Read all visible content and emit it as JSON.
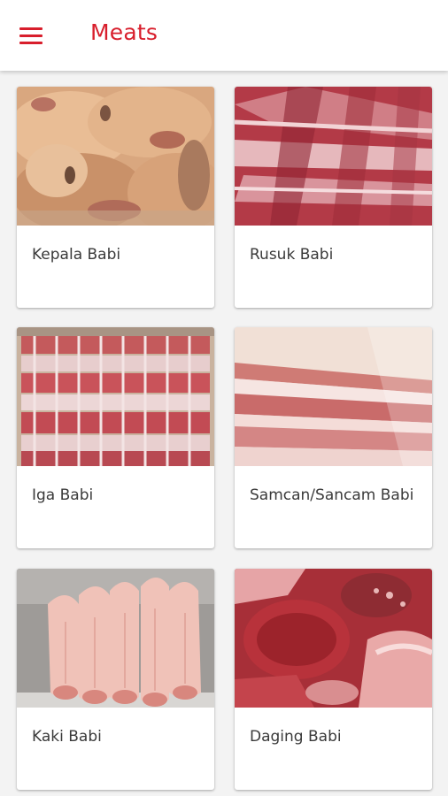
{
  "app": {
    "title": "Meats",
    "accent_color": "#d81e2c"
  },
  "toolbar": {
    "menu_icon": "hamburger-menu-icon"
  },
  "items": [
    {
      "label": "Kepala Babi"
    },
    {
      "label": "Rusuk Babi"
    },
    {
      "label": "Iga Babi"
    },
    {
      "label": "Samcan/Sancam Babi"
    },
    {
      "label": "Kaki Babi"
    },
    {
      "label": "Daging Babi"
    }
  ]
}
